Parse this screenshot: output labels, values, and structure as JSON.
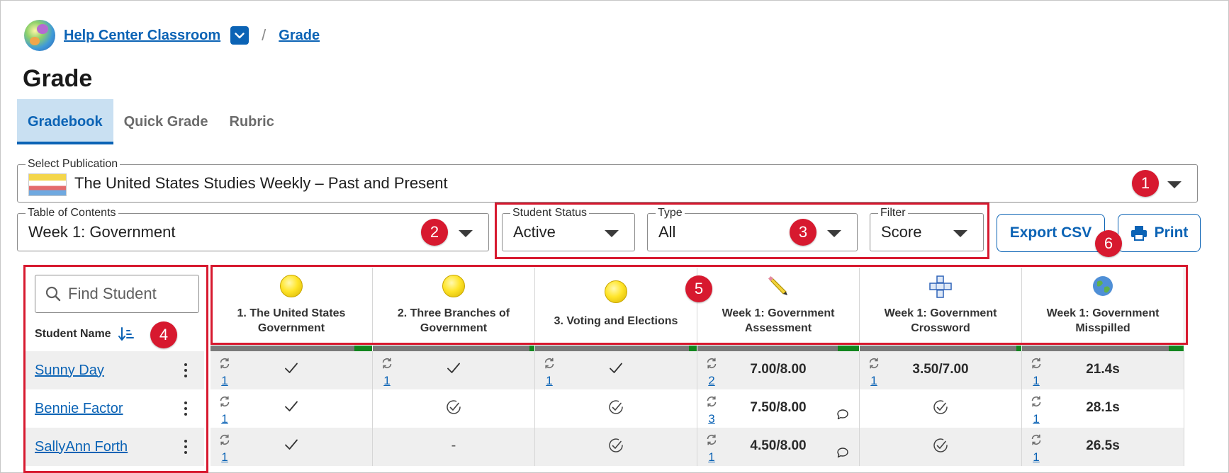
{
  "breadcrumb": {
    "classroom": "Help Center Classroom",
    "separator": "/",
    "current": "Grade"
  },
  "page_title": "Grade",
  "tabs": [
    {
      "label": "Gradebook",
      "active": true
    },
    {
      "label": "Quick Grade",
      "active": false
    },
    {
      "label": "Rubric",
      "active": false
    }
  ],
  "publication": {
    "label": "Select Publication",
    "value": "The United States Studies Weekly – Past and Present"
  },
  "toc": {
    "label": "Table of Contents",
    "value": "Week 1: Government"
  },
  "student_status": {
    "label": "Student Status",
    "value": "Active"
  },
  "type_filter": {
    "label": "Type",
    "value": "All"
  },
  "filter": {
    "label": "Filter",
    "value": "Score"
  },
  "buttons": {
    "export_csv": "Export CSV",
    "print": "Print"
  },
  "badges": [
    "1",
    "2",
    "3",
    "4",
    "5",
    "6"
  ],
  "search": {
    "placeholder": "Find Student"
  },
  "student_header": "Student Name",
  "students": [
    {
      "name": "Sunny Day"
    },
    {
      "name": "Bennie Factor"
    },
    {
      "name": "SallyAnn Forth"
    }
  ],
  "columns": [
    {
      "title_line1": "1. The United States",
      "title_line2": "Government",
      "icon": "coin-icon",
      "completion": 0.11
    },
    {
      "title_line1": "2. Three Branches of",
      "title_line2": "Government",
      "icon": "coin-icon",
      "completion": 0.03
    },
    {
      "title_line1": "3. Voting and Elections",
      "title_line2": "",
      "icon": "coin-icon",
      "completion": 0.05
    },
    {
      "title_line1": "Week 1: Government",
      "title_line2": "Assessment",
      "icon": "pencil-icon",
      "completion": 0.13
    },
    {
      "title_line1": "Week 1: Government",
      "title_line2": "Crossword",
      "icon": "crossword-icon",
      "completion": 0.03
    },
    {
      "title_line1": "Week 1: Government",
      "title_line2": "Misspilled",
      "icon": "earth-icon",
      "completion": 0.09
    }
  ],
  "rows": [
    [
      {
        "attempts": "1",
        "kind": "check"
      },
      {
        "attempts": "1",
        "kind": "check"
      },
      {
        "attempts": "1",
        "kind": "check"
      },
      {
        "attempts": "2",
        "kind": "score",
        "value": "7.00/8.00"
      },
      {
        "attempts": "1",
        "kind": "score",
        "value": "3.50/7.00"
      },
      {
        "attempts": "1",
        "kind": "score",
        "value": "21.4s"
      }
    ],
    [
      {
        "attempts": "1",
        "kind": "check"
      },
      {
        "kind": "circle-check"
      },
      {
        "kind": "circle-check"
      },
      {
        "attempts": "3",
        "kind": "score",
        "value": "7.50/8.00",
        "comment": true
      },
      {
        "kind": "circle-check"
      },
      {
        "attempts": "1",
        "kind": "score",
        "value": "28.1s"
      }
    ],
    [
      {
        "attempts": "1",
        "kind": "check"
      },
      {
        "kind": "dash",
        "value": "-"
      },
      {
        "kind": "circle-check"
      },
      {
        "attempts": "1",
        "kind": "score",
        "value": "4.50/8.00",
        "comment": true
      },
      {
        "kind": "circle-check"
      },
      {
        "attempts": "1",
        "kind": "score",
        "value": "26.5s"
      }
    ]
  ],
  "colors": {
    "accent": "#0b63b5",
    "annotation": "#d7192f",
    "complete": "#12861f",
    "tab_active_bg": "#c9e0f2"
  }
}
